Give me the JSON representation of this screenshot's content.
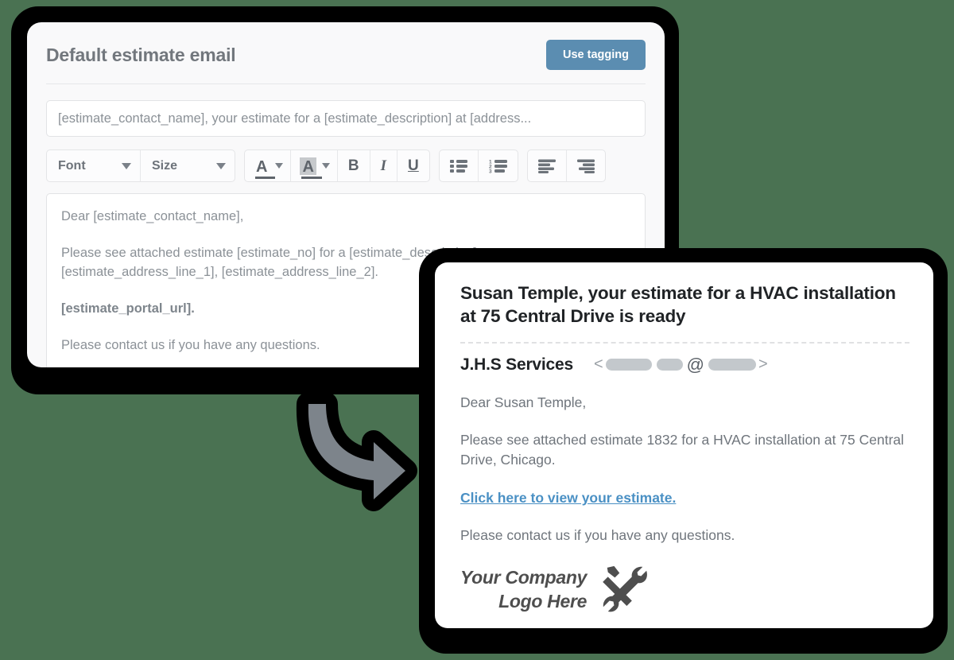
{
  "editor": {
    "title": "Default estimate email",
    "tagging_button": "Use tagging",
    "subject_value": "[estimate_contact_name], your estimate for a [estimate_description] at [address...",
    "toolbar": {
      "font_label": "Font",
      "size_label": "Size",
      "text_color_glyph": "A",
      "highlight_color_glyph": "A",
      "bold_label": "B",
      "italic_label": "I",
      "underline_label": "U",
      "bullet_list_icon": "bullet-list-icon",
      "numbered_list_icon": "numbered-list-icon",
      "align_left_icon": "align-left-icon",
      "align_right_icon": "align-right-icon",
      "numbered_list_digits": [
        "1",
        "2",
        "3"
      ]
    },
    "body": {
      "greeting": "Dear [estimate_contact_name],",
      "paragraph": "Please see attached estimate [estimate_no] for a [estimate_description] at [estimate_address_line_1], [estimate_address_line_2].",
      "portal_link": "[estimate_portal_url].",
      "closing": "Please contact us if you have any questions."
    }
  },
  "arrow": {
    "icon": "curved-arrow-icon",
    "fill": "#7d848b",
    "outline": "#000000"
  },
  "preview": {
    "subject": "Susan Temple, your estimate for a HVAC installation at 75 Central Drive is ready",
    "sender_name": "J.H.S Services",
    "email_open_angle": "<",
    "email_at": "@",
    "email_close_angle": ">",
    "body": {
      "greeting": "Dear Susan Temple,",
      "paragraph": "Please see attached estimate 1832 for a HVAC installation at 75 Central Drive, Chicago.",
      "link": "Click here to view your estimate.",
      "closing": "Please contact us if you have any questions."
    },
    "logo": {
      "line1": "Your Company",
      "line2": "Logo Here",
      "icon": "wrench-screwdriver-icon"
    }
  },
  "colors": {
    "background": "#4a7252",
    "accent_button": "#5b8db1",
    "link": "#4a90c4",
    "title_text": "#72777d",
    "body_text": "#8b9197",
    "preview_heading": "#202326"
  }
}
